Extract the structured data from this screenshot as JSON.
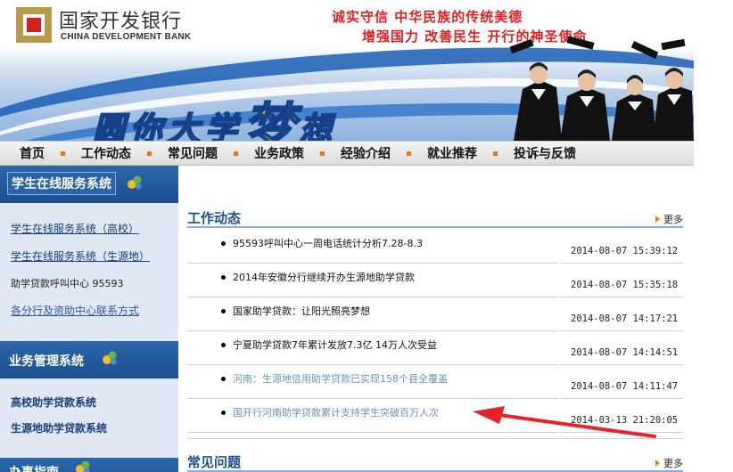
{
  "header": {
    "logo_cn": "国家开发银行",
    "logo_en": "CHINA DEVELOPMENT BANK",
    "slogan_line1": "诚实守信 中华民族的传统美德",
    "slogan_line2": "增强国力 改善民生 开行的神圣使命",
    "banner_chars": [
      "圆",
      "你",
      "大",
      "学",
      "梦",
      "想"
    ]
  },
  "nav": {
    "items": [
      "首页",
      "工作动态",
      "常见问题",
      "业务政策",
      "经验介绍",
      "就业推荐",
      "投诉与反馈"
    ]
  },
  "sidebar": {
    "student_system": {
      "title": "学生在线服务系统",
      "links": [
        "学生在线服务系统（高校）",
        "学生在线服务系统（生源地）"
      ],
      "hotline": "助学贷款呼叫中心 95593",
      "contact_link": "各分行及资助中心联系方式"
    },
    "business_system": {
      "title": "业务管理系统",
      "links": [
        "高校助学贷款系统",
        "生源地助学贷款系统"
      ]
    },
    "third_title": "办事指南"
  },
  "main": {
    "work_news": {
      "title": "工作动态",
      "more": "更多",
      "items": [
        {
          "title": "95593呼叫中心一周电话统计分析7.28-8.3",
          "date": "2014-08-07 15:39:12",
          "visited": false
        },
        {
          "title": "2014年安徽分行继续开办生源地助学贷款",
          "date": "2014-08-07 15:35:18",
          "visited": false
        },
        {
          "title": "国家助学贷款：让阳光照亮梦想",
          "date": "2014-08-07 14:17:21",
          "visited": false
        },
        {
          "title": "宁夏助学贷款7年累计发放7.3亿 14万人次受益",
          "date": "2014-08-07 14:14:51",
          "visited": false
        },
        {
          "title": "河南：生源地信用助学贷款已实现158个县全覆盖",
          "date": "2014-08-07 14:11:47",
          "visited": true
        },
        {
          "title": "国开行河南助学贷款累计支持学生突破百万人次",
          "date": "2014-03-13 21:20:05",
          "visited": true
        }
      ]
    },
    "faq": {
      "title": "常见问题",
      "more": "更多"
    }
  },
  "colors": {
    "brand_blue": "#1d4f8f",
    "slogan_red": "#e02020",
    "nav_dot": "#e07a10",
    "visited_link": "#6d8fb8"
  }
}
